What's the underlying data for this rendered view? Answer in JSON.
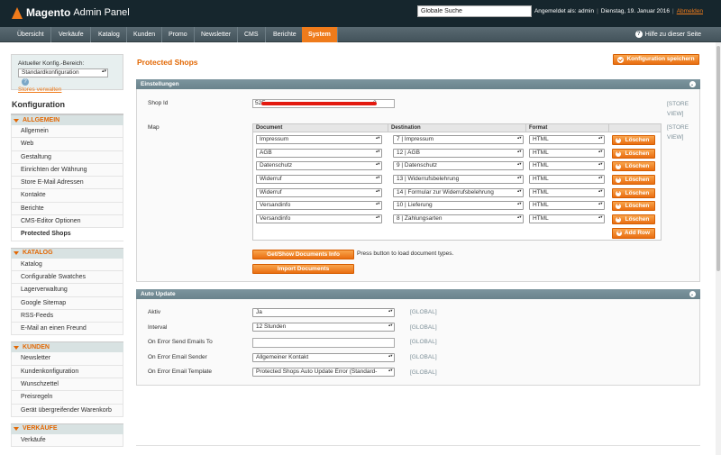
{
  "header": {
    "brand": "Magento",
    "panel": "Admin Panel",
    "search_value": "Globale Suche",
    "logged_in": "Angemeldet als: admin",
    "date": "Dienstag, 19. Januar 2016",
    "logout": "Abmelden"
  },
  "nav": {
    "items": [
      "Übersicht",
      "Verkäufe",
      "Katalog",
      "Kunden",
      "Promo",
      "Newsletter",
      "CMS",
      "Berichte",
      "System"
    ],
    "active": "System",
    "help": "Hilfe zu dieser Seite"
  },
  "sidebar": {
    "scope_label": "Aktueller Konfig.-Bereich:",
    "scope_value": "Standardkonfiguration",
    "stores_link": "Stores verwalten",
    "title": "Konfiguration",
    "groups": [
      {
        "title": "ALLGEMEIN",
        "items": [
          "Allgemein",
          "Web",
          "Gestaltung",
          "Einrichten der Währung",
          "Store E-Mail Adressen",
          "Kontakte",
          "Berichte",
          "CMS-Editor Optionen",
          "Protected Shops"
        ]
      },
      {
        "title": "KATALOG",
        "items": [
          "Katalog",
          "Configurable Swatches",
          "Lagerverwaltung",
          "Google Sitemap",
          "RSS-Feeds",
          "E-Mail an einen Freund"
        ]
      },
      {
        "title": "KUNDEN",
        "items": [
          "Newsletter",
          "Kundenkonfiguration",
          "Wunschzettel",
          "Preisregeln",
          "Gerät übergreifender Warenkorb"
        ]
      },
      {
        "title": "VERKÄUFE",
        "items": [
          "Verkäufe"
        ]
      }
    ],
    "active_item": "Protected Shops"
  },
  "page": {
    "title": "Protected Shops",
    "save_button": "Konfiguration speichern"
  },
  "settings": {
    "title": "Einstellungen",
    "shop_id_label": "Shop Id",
    "shop_id_prefix": "52E",
    "shop_id_suffix": "2",
    "store_view_tag": "[STORE VIEW]",
    "map_label": "Map",
    "map_headers": [
      "Document",
      "Destination",
      "Format"
    ],
    "map_rows": [
      {
        "document": "Impressum",
        "destination": "7 | Impressum",
        "format": "HTML"
      },
      {
        "document": "AGB",
        "destination": "12 | AGB",
        "format": "HTML"
      },
      {
        "document": "Datenschutz",
        "destination": "9 | Datenschutz",
        "format": "HTML"
      },
      {
        "document": "Widerruf",
        "destination": "13 | Widerrufsbelehrung",
        "format": "HTML"
      },
      {
        "document": "Widerruf",
        "destination": "14 | Formular zur Widerrufsbelehrung",
        "format": "HTML"
      },
      {
        "document": "Versandinfo",
        "destination": "10 | Lieferung",
        "format": "HTML"
      },
      {
        "document": "Versandinfo",
        "destination": "8 | Zahlungsarten",
        "format": "HTML"
      }
    ],
    "delete_label": "Löschen",
    "add_row_label": "Add Row",
    "get_docs_button": "Get/Show Documents Info",
    "get_docs_hint": "Press button to load document types.",
    "import_button": "Import Documents"
  },
  "auto_update": {
    "title": "Auto Update",
    "scope_tag": "[GLOBAL]",
    "fields": [
      {
        "label": "Aktiv",
        "value": "Ja",
        "type": "select"
      },
      {
        "label": "Interval",
        "value": "12 Stunden",
        "type": "select"
      },
      {
        "label": "On Error Send Emails To",
        "value": "",
        "type": "text"
      },
      {
        "label": "On Error Email Sender",
        "value": "Allgemeiner Kontakt",
        "type": "select"
      },
      {
        "label": "On Error Email Template",
        "value": "Protected Shops Auto Update Error (Standard-",
        "type": "select"
      }
    ]
  }
}
